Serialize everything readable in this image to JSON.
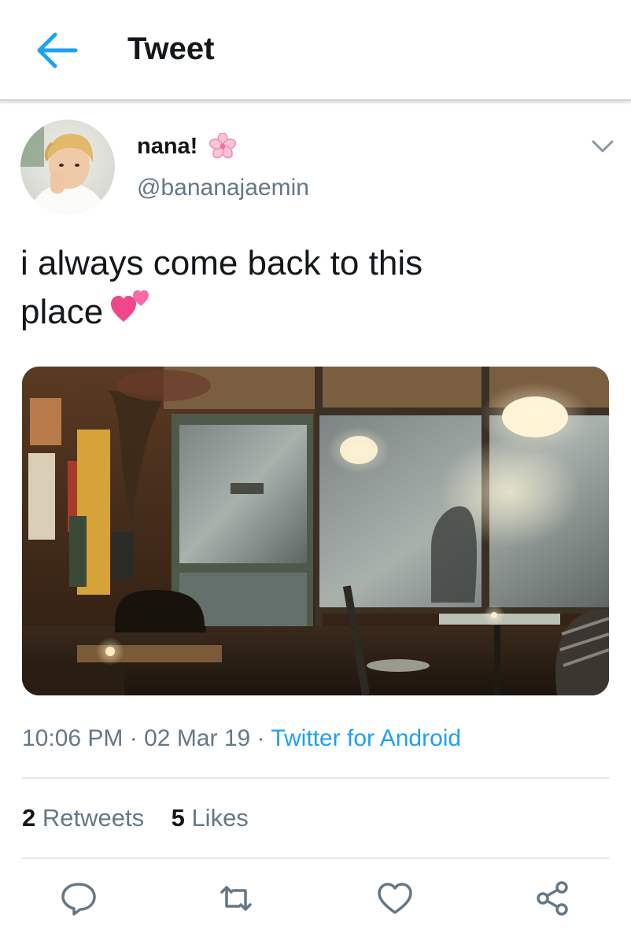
{
  "header": {
    "title": "Tweet",
    "back_icon": "arrow-left-icon"
  },
  "tweet": {
    "display_name": "nana!",
    "name_emoji": "cherry-blossom-icon",
    "username": "@bananajaemin",
    "text_line1": "i always come back to this",
    "text_line2": "place",
    "text_emoji": "two-hearts-icon",
    "time": "10:06 PM",
    "date": "02 Mar 19",
    "source": "Twitter for Android",
    "separator": "·",
    "retweets_count": "2",
    "retweets_label": "Retweets",
    "likes_count": "5",
    "likes_label": "Likes"
  },
  "actions": [
    "reply-icon",
    "retweet-icon",
    "like-icon",
    "share-icon"
  ],
  "colors": {
    "accent": "#1da1f2",
    "text": "#14171a",
    "secondary": "#657786",
    "divider": "#e1e8ed"
  }
}
